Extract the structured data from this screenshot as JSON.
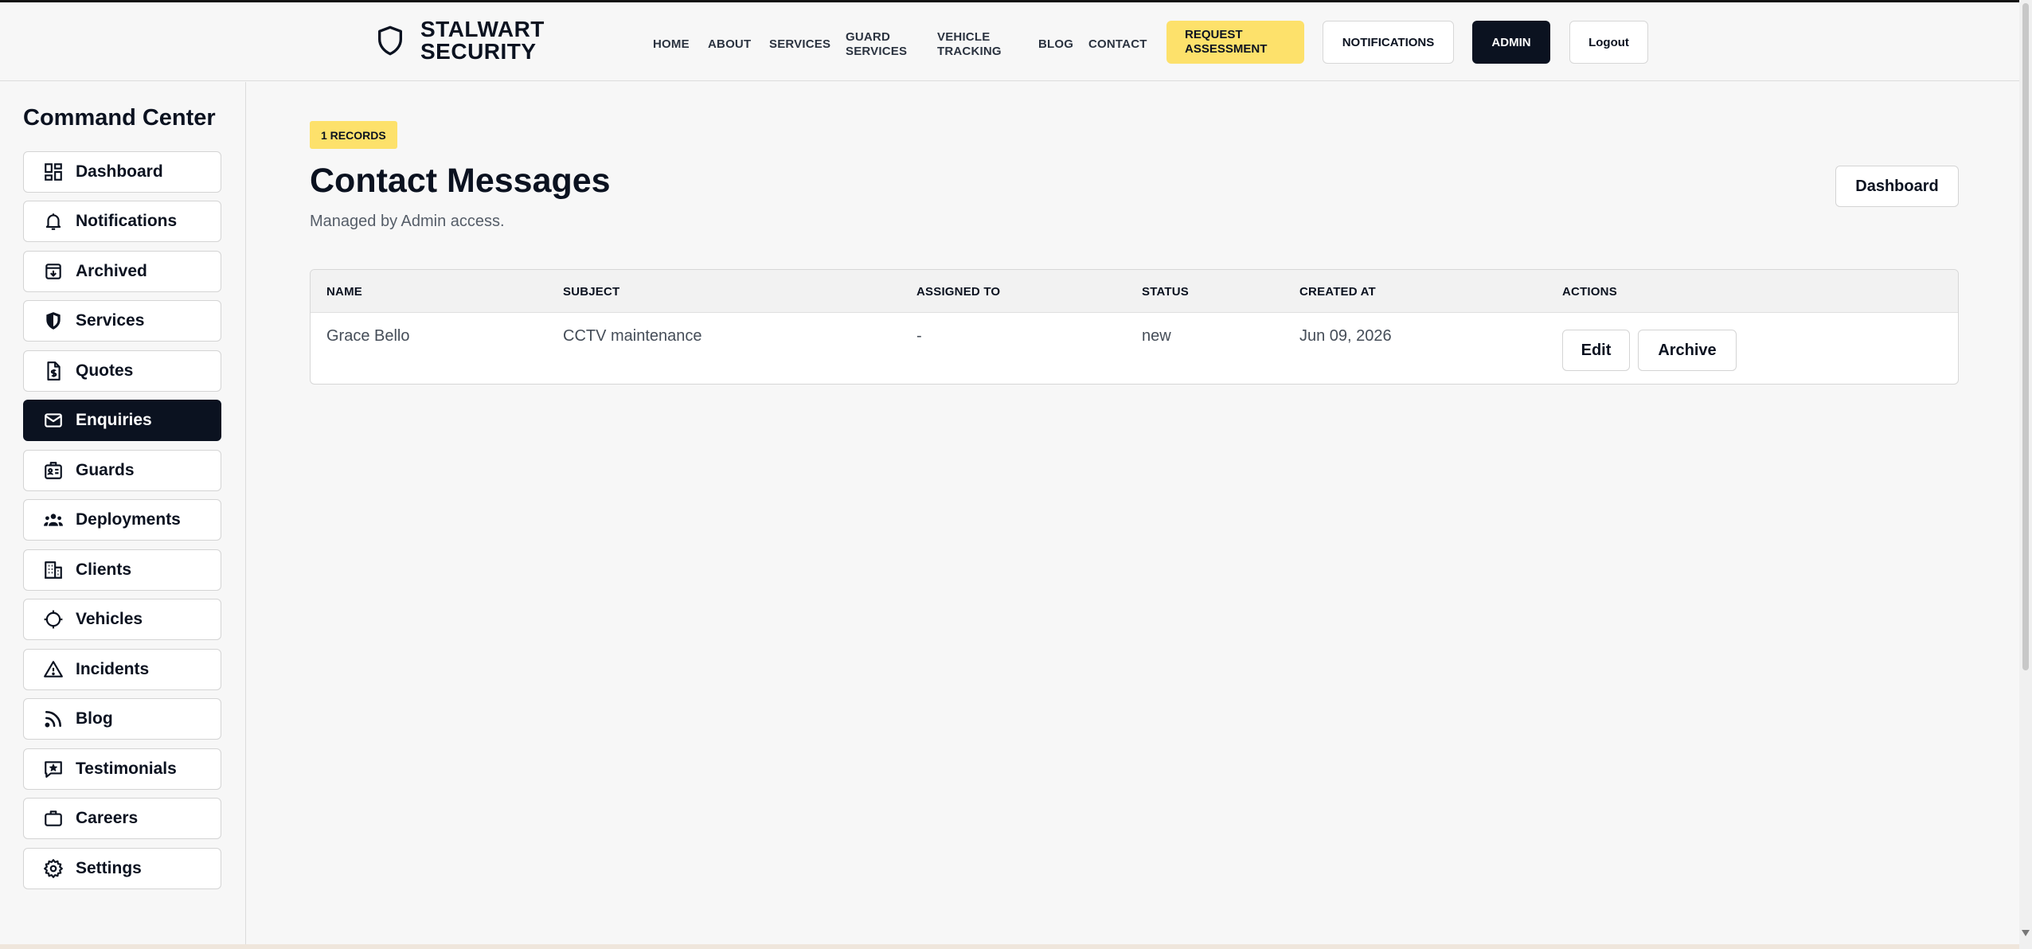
{
  "brand": {
    "line1": "STALWART",
    "line2": "SECURITY",
    "icon": "shield-icon"
  },
  "nav": {
    "items": [
      "HOME",
      "ABOUT",
      "SERVICES",
      "GUARD SERVICES",
      "VEHICLE TRACKING",
      "BLOG",
      "CONTACT"
    ],
    "request_label": "REQUEST ASSESSMENT",
    "notifications_label": "NOTIFICATIONS",
    "admin_label": "ADMIN",
    "logout_label": "Logout"
  },
  "sidebar": {
    "title": "Command Center",
    "items": [
      {
        "label": "Dashboard",
        "icon": "dashboard-icon"
      },
      {
        "label": "Notifications",
        "icon": "bell-icon"
      },
      {
        "label": "Archived",
        "icon": "archive-icon"
      },
      {
        "label": "Services",
        "icon": "shield-icon"
      },
      {
        "label": "Quotes",
        "icon": "quote-document-icon"
      },
      {
        "label": "Enquiries",
        "icon": "mail-icon",
        "active": true
      },
      {
        "label": "Guards",
        "icon": "id-badge-icon"
      },
      {
        "label": "Deployments",
        "icon": "users-icon"
      },
      {
        "label": "Clients",
        "icon": "building-icon"
      },
      {
        "label": "Vehicles",
        "icon": "crosshair-icon"
      },
      {
        "label": "Incidents",
        "icon": "warning-icon"
      },
      {
        "label": "Blog",
        "icon": "rss-icon"
      },
      {
        "label": "Testimonials",
        "icon": "star-message-icon"
      },
      {
        "label": "Careers",
        "icon": "briefcase-icon"
      },
      {
        "label": "Settings",
        "icon": "gear-icon"
      }
    ]
  },
  "main": {
    "badge": "1 RECORDS",
    "title": "Contact Messages",
    "subtitle": "Managed by Admin access.",
    "dashboard_button": "Dashboard",
    "table": {
      "columns": [
        "NAME",
        "SUBJECT",
        "ASSIGNED TO",
        "STATUS",
        "CREATED AT",
        "ACTIONS"
      ],
      "rows": [
        {
          "name": "Grace Bello",
          "subject": "CCTV maintenance",
          "assigned_to": "-",
          "status": "new",
          "created_at": "Jun 09, 2026",
          "edit_label": "Edit",
          "archive_label": "Archive"
        }
      ]
    }
  },
  "colors": {
    "accent_yellow": "#fde16b",
    "dark": "#0b1220",
    "background": "#f7f7f7"
  }
}
